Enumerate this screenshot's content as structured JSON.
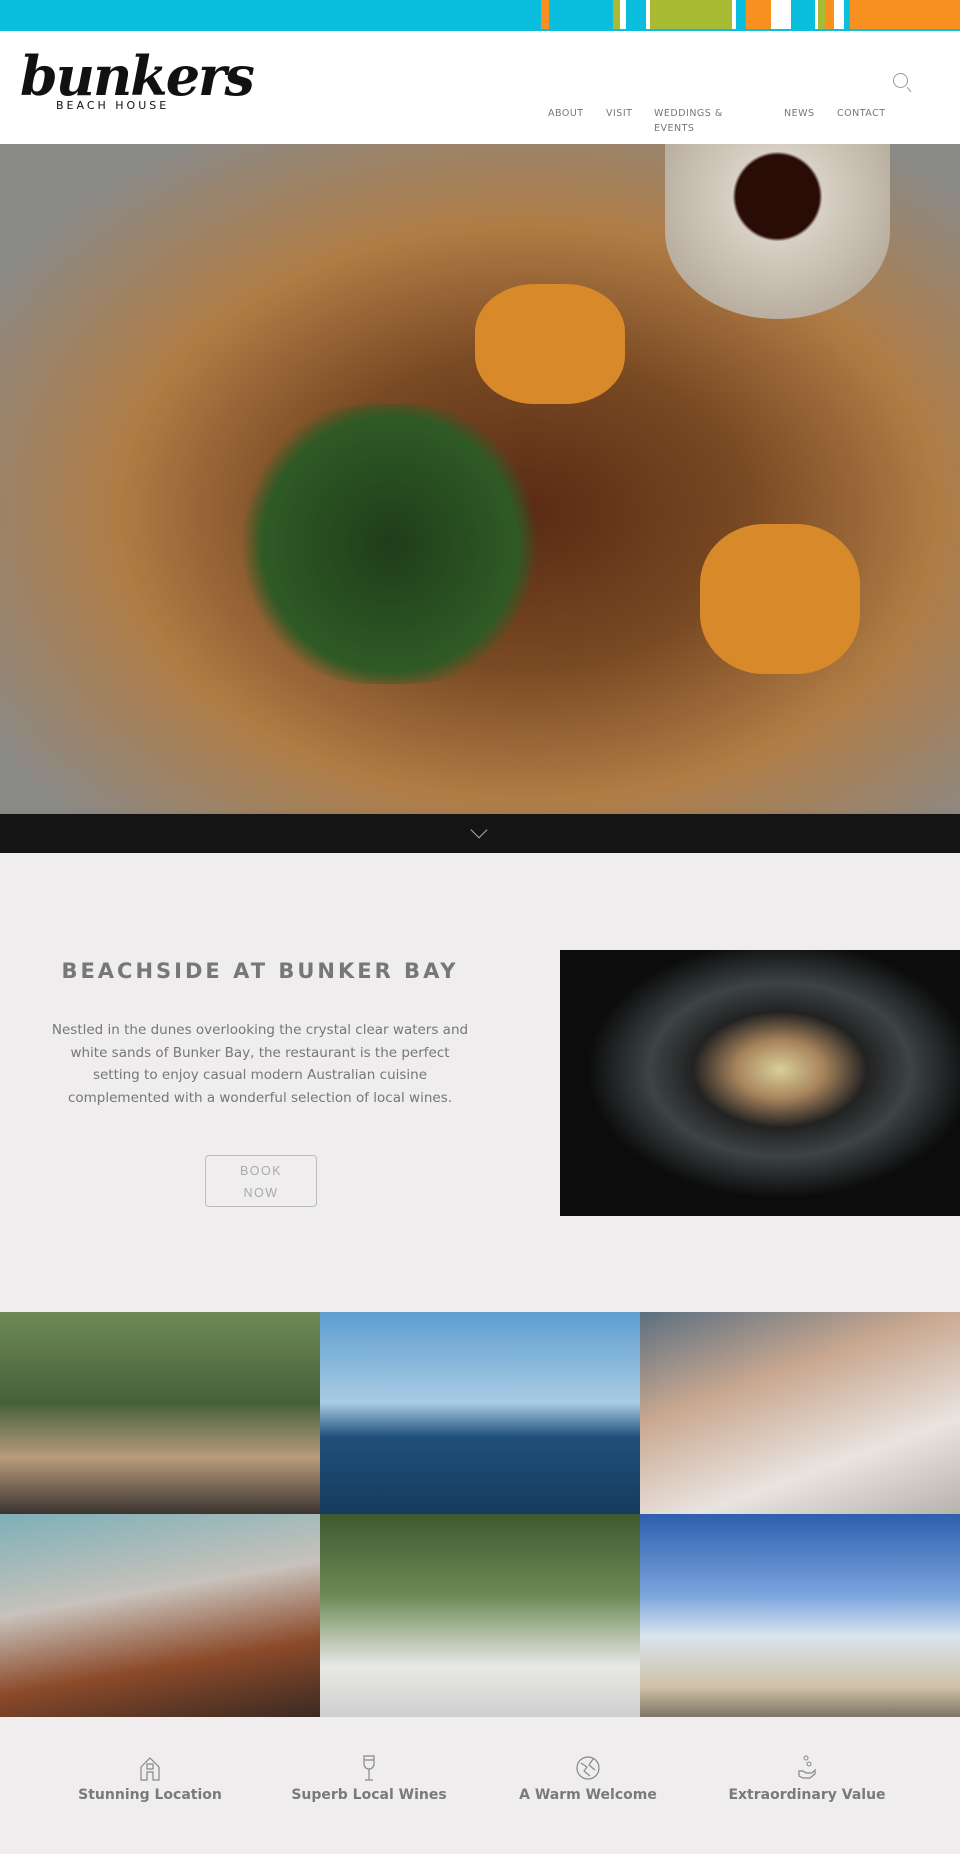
{
  "brand": {
    "logo_word": "bunkers",
    "logo_sub": "BEACH HOUSE",
    "stripe_colors": [
      "#0bbede",
      "#f7901e",
      "#a9ba33",
      "#ffffff"
    ]
  },
  "nav": {
    "items": [
      {
        "label": "ABOUT"
      },
      {
        "label": "VISIT"
      },
      {
        "label": "WEDDINGS & EVENTS"
      },
      {
        "label": "NEWS"
      },
      {
        "label": "CONTACT"
      }
    ],
    "search_icon": "search-icon"
  },
  "hero": {
    "image": "steak-on-board-photo",
    "scroll_icon": "chevron-down-icon"
  },
  "intro": {
    "heading": "BEACHSIDE AT BUNKER BAY",
    "body": "Nestled in the dunes overlooking the crystal clear waters and white sands of Bunker Bay, the restaurant is the perfect setting to enjoy casual modern Australian cuisine complemented with a wonderful selection of local wines.",
    "button": "BOOK NOW",
    "image": "plated-dish-photo"
  },
  "gallery": [
    "restaurant-exterior-photo",
    "whale-breaching-photo",
    "diners-photo",
    "breakfast-photo",
    "wine-pouring-photo",
    "beach-wedding-photo"
  ],
  "features": [
    {
      "icon": "house-icon",
      "label": "Stunning Location"
    },
    {
      "icon": "wine-glass-icon",
      "label": "Superb Local Wines"
    },
    {
      "icon": "handshake-icon",
      "label": "A Warm Welcome"
    },
    {
      "icon": "hand-coins-icon",
      "label": "Extraordinary Value"
    }
  ]
}
